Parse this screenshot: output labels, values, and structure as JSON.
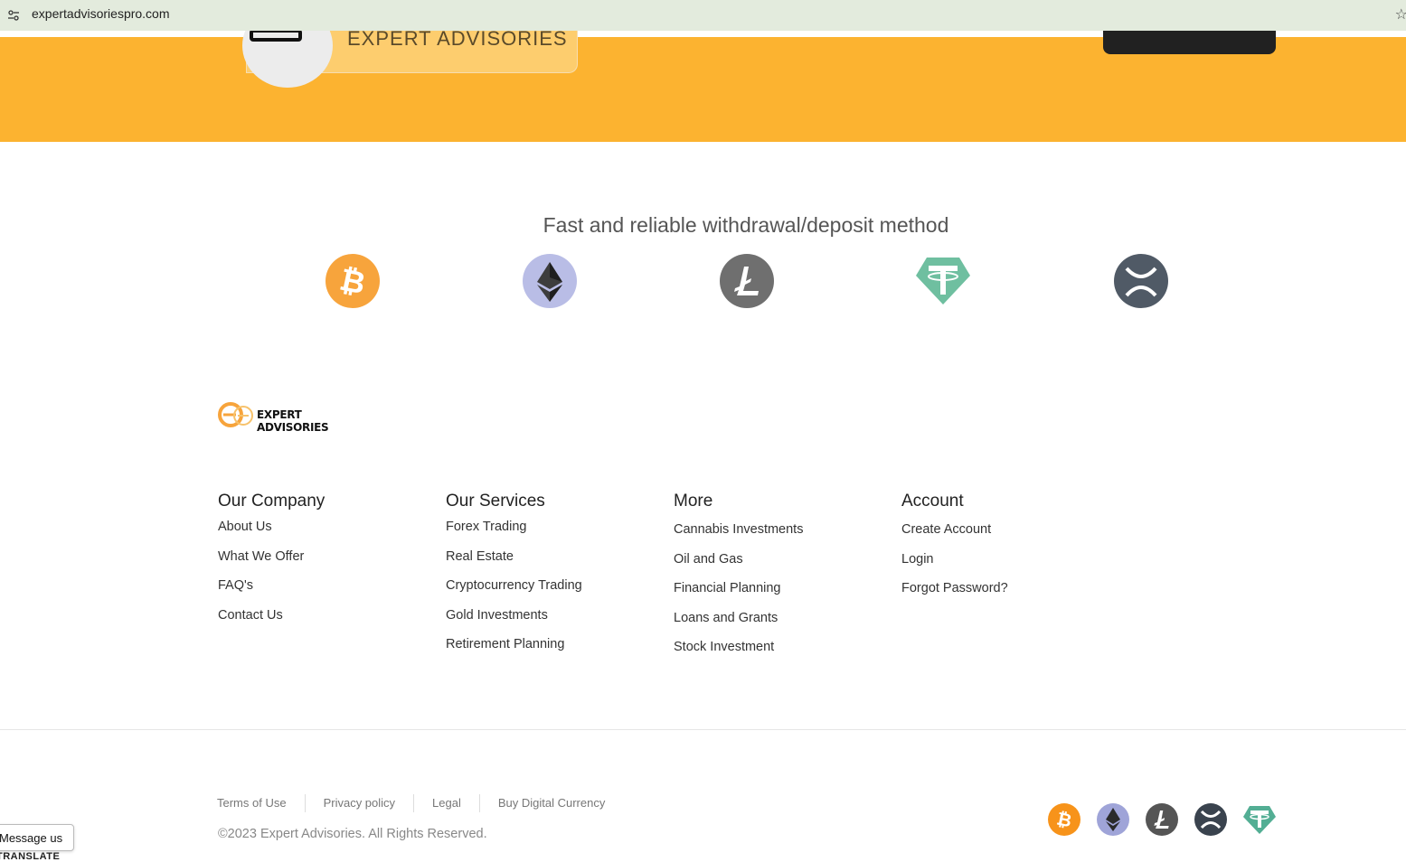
{
  "browser": {
    "url": "expertadvisoriespro.com",
    "site_info_icon": "tune-icon",
    "bookmark_icon": "star-icon"
  },
  "hero": {
    "brand_name": "EXPERT ADVISORIES",
    "background_color": "#fcb330",
    "button_color": "#212121"
  },
  "payment": {
    "title": "Fast and reliable withdrawal/deposit method",
    "coins": [
      {
        "name": "bitcoin",
        "icon": "bitcoin-icon",
        "color": "#f7a43c"
      },
      {
        "name": "ethereum",
        "icon": "ethereum-icon",
        "color": "#b9bde6"
      },
      {
        "name": "litecoin",
        "icon": "litecoin-icon",
        "color": "#6f6f6f"
      },
      {
        "name": "tether",
        "icon": "tether-icon",
        "color": "#6fbfa0"
      },
      {
        "name": "ripple",
        "icon": "xrp-icon",
        "color": "#505a66"
      }
    ]
  },
  "footer": {
    "logo_text": "EXPERT ADVISORIES",
    "columns": [
      {
        "title": "Our Company",
        "links": [
          "About Us",
          "What We Offer",
          "FAQ's",
          "Contact Us"
        ]
      },
      {
        "title": "Our Services",
        "links": [
          "Forex Trading",
          "Real Estate",
          "Cryptocurrency Trading",
          "Gold Investments",
          "Retirement Planning"
        ]
      },
      {
        "title": "More",
        "links": [
          "Cannabis Investments",
          "Oil and Gas",
          "Financial Planning",
          "Loans and Grants",
          "Stock Investment"
        ]
      },
      {
        "title": "Account",
        "links": [
          "Create Account",
          "Login",
          "Forgot Password?"
        ]
      }
    ],
    "legal_links": [
      "Terms of Use",
      "Privacy policy",
      "Legal",
      "Buy Digital Currency"
    ],
    "copyright": "©2023 Expert Advisories. All Rights Reserved."
  },
  "widgets": {
    "message_label": "Message us",
    "translate_label": "TRANSLATE"
  }
}
